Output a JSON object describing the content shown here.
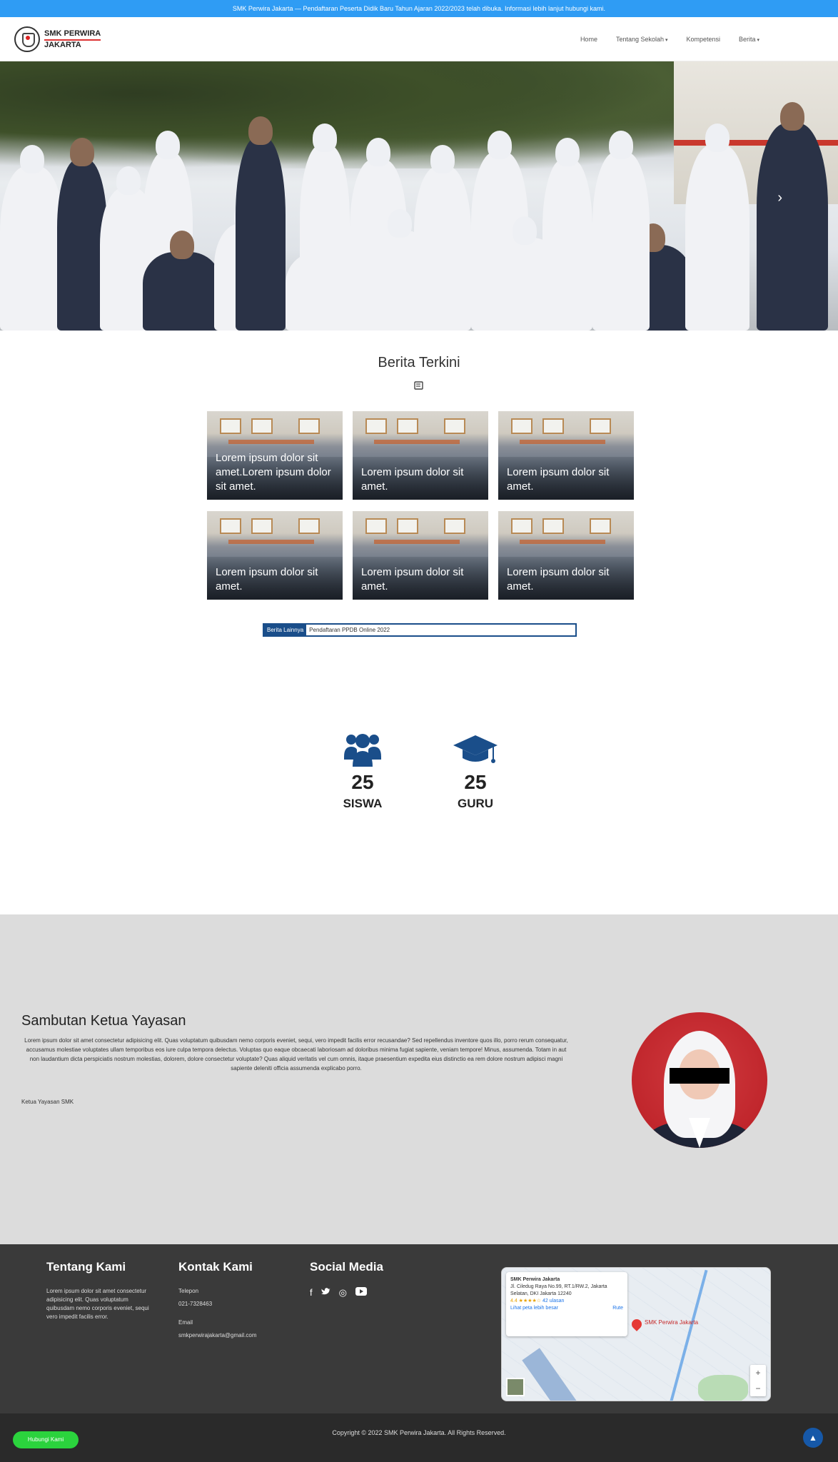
{
  "ticker": {
    "text": "SMK Perwira Jakarta — Pendaftaran Peserta Didik Baru Tahun Ajaran 2022/2023 telah dibuka. Informasi lebih lanjut hubungi kami."
  },
  "header": {
    "logo_line1": "SMK PERWIRA",
    "logo_line2": "JAKARTA",
    "nav": [
      {
        "label": "Home"
      },
      {
        "label": "Tentang Sekolah"
      },
      {
        "label": "Kompetensi"
      },
      {
        "label": "Berita"
      }
    ]
  },
  "hero": {
    "next_icon": "chevron-right-icon"
  },
  "news": {
    "title": "Berita Terkini",
    "icon": "newspaper-icon",
    "cards": [
      {
        "caption": "Lorem ipsum dolor sit amet.Lorem ipsum dolor sit amet."
      },
      {
        "caption": "Lorem ipsum dolor sit amet."
      },
      {
        "caption": "Lorem ipsum dolor sit amet."
      },
      {
        "caption": "Lorem ipsum dolor sit amet."
      },
      {
        "caption": "Lorem ipsum dolor sit amet."
      },
      {
        "caption": "Lorem ipsum dolor sit amet."
      }
    ],
    "search_label": "Berita Lainnya",
    "search_value": "Pendaftaran PPDB Online 2022"
  },
  "stats": [
    {
      "icon": "users-icon",
      "value": "25",
      "label": "SISWA"
    },
    {
      "icon": "graduation-cap-icon",
      "value": "25",
      "label": "GURU"
    }
  ],
  "sambutan": {
    "title": "Sambutan Ketua Yayasan",
    "body": "Lorem ipsum dolor sit amet consectetur adipisicing elit. Quas voluptatum quibusdam nemo corporis eveniet, sequi, vero impedit facilis error recusandae? Sed repellendus inventore quos illo, porro rerum consequatur, accusamus molestiae voluptates ullam temporibus eos iure culpa tempora delectus. Voluptas quo eaque obcaecati laboriosam ad doloribus minima fugiat sapiente, veniam tempore! Minus, assumenda. Totam in aut non laudantium dicta perspiciatis nostrum molestias, dolorem, dolore consectetur voluptate? Quas aliquid veritatis vel cum omnis, itaque praesentium expedita eius distinctio ea rem dolore nostrum adipisci magni sapiente deleniti officia assumenda explicabo porro.",
    "signature": "Ketua Yayasan SMK"
  },
  "footer": {
    "about_title": "Tentang Kami",
    "about_text": "Lorem ipsum dolor sit amet consectetur adipisicing elit. Quas voluptatum quibusdam nemo corporis eveniet, sequi vero impedit facilis error.",
    "contact_title": "Kontak Kami",
    "phone_label": "Telepon",
    "phone": "021-7328463",
    "email_label": "Email",
    "email": "smkperwirajakarta@gmail.com",
    "social_title": "Social Media",
    "socials": [
      {
        "icon": "facebook-icon",
        "glyph": "f"
      },
      {
        "icon": "twitter-icon",
        "glyph": "🐦"
      },
      {
        "icon": "instagram-icon",
        "glyph": "◎"
      },
      {
        "icon": "youtube-icon",
        "glyph": "▶"
      }
    ],
    "map": {
      "place_name": "SMK Perwira Jakarta",
      "address": "Jl. Ciledug Raya No.99, RT.1/RW.2, Jakarta Selatan, DKI Jakarta 12240",
      "rating": "4.4 ★★★★☆",
      "reviews_link": "42 ulasan",
      "larger_map": "Lihat peta lebih besar",
      "directions": "Rute",
      "pin_label": "SMK Perwira Jakarta"
    },
    "copyright": "Copyright © 2022 SMK Perwira Jakarta. All Rights Reserved."
  },
  "whatsapp_label": "Hubungi Kami",
  "totop_icon": "arrow-up-icon",
  "colors": {
    "ticker": "#2f9cf4",
    "primary": "#1a4e8a",
    "footer": "#3a3a3a",
    "whatsapp": "#2bd33d"
  }
}
